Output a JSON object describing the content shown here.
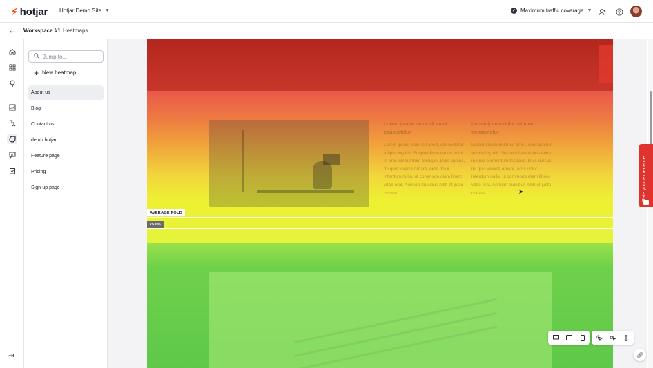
{
  "topbar": {
    "logo_text": "hotjar",
    "site_name": "Hotjar Demo Site",
    "coverage_label": "Maximum traffic coverage",
    "icons": [
      "add-user-icon",
      "help-icon",
      "avatar"
    ]
  },
  "breadcrumb": {
    "workspace": "Workspace #1",
    "section": "Heatmaps"
  },
  "rail": {
    "icons": [
      "home-icon",
      "dashboard-icon",
      "lightbulb-icon",
      "trends-icon",
      "funnels-icon",
      "heatmaps-icon",
      "feedback-icon",
      "surveys-icon"
    ]
  },
  "sidepanel": {
    "search_placeholder": "Jump to...",
    "new_heatmap_label": "New heatmap",
    "pages": [
      {
        "label": "About us",
        "selected": true
      },
      {
        "label": "Blog"
      },
      {
        "label": "Contact us"
      },
      {
        "label": "demo.hotjar"
      },
      {
        "label": "Feature page"
      },
      {
        "label": "Pricing"
      },
      {
        "label": "Sign-up page"
      }
    ]
  },
  "heatmap": {
    "column1_title": "Lorem ipsum dolor sit amet consectetur",
    "column1_body": "Lorem ipsum dolor sit amet, consectetur adipiscing elit. Suspendisse varius enim in eros elementum tristique. Duis cursus, mi quis viverra ornare, eros dolor interdum nulla, ut commodo diam libero vitae erat. Aenean faucibus nibh et justo cursus",
    "column2_title": "Lorem ipsum dolor sit amet consectetur",
    "column2_body": "Lorem ipsum dolor sit amet, consectetur adipiscing elit. Suspendisse varius enim in eros elementum tristique. Duis cursus, mi quis viverra ornare, eros dolor interdum nulla, ut commodo diam libero vitae erat. Aenean faucibus nibh et justo cursus",
    "average_fold_label": "AVERAGE FOLD",
    "fold_percentage": "75.0%"
  },
  "toolbar": {
    "device_icons": [
      "desktop-icon",
      "tablet-icon",
      "mobile-icon"
    ],
    "map_icons": [
      "click-map-icon",
      "move-map-icon",
      "scroll-map-icon"
    ]
  },
  "feedback_tab": {
    "label": "Rate your experience"
  },
  "colors": {
    "brand": "#ff3c00",
    "feedback": "#e0332e",
    "heat_hot": "#b3271e",
    "heat_cold": "#5fc84a"
  }
}
